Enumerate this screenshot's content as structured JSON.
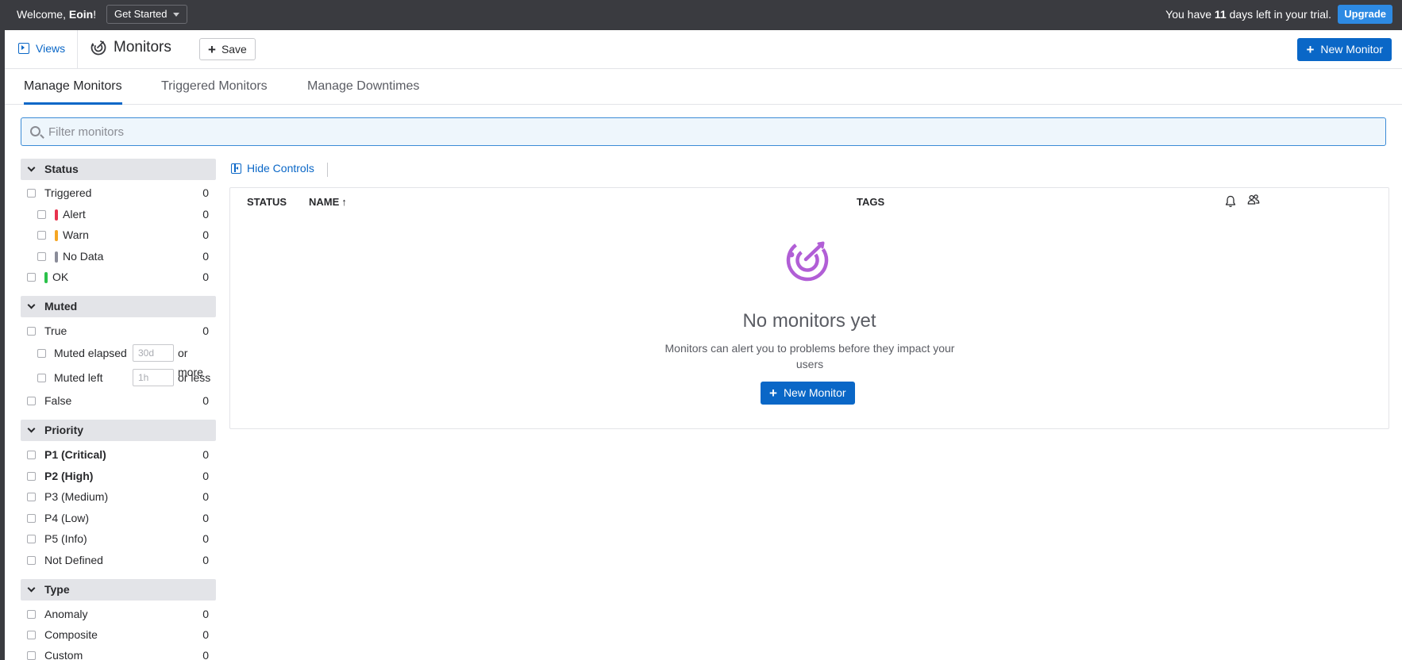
{
  "topbar": {
    "welcome_prefix": "Welcome, ",
    "user_name": "Eoin",
    "welcome_suffix": "!",
    "get_started": "Get Started",
    "trial_prefix": "You have ",
    "trial_days": "11",
    "trial_suffix": " days left in your trial.",
    "upgrade": "Upgrade"
  },
  "header": {
    "views": "Views",
    "title": "Monitors",
    "save": "Save",
    "new_monitor": "New Monitor"
  },
  "tabs": [
    {
      "label": "Manage Monitors",
      "active": true
    },
    {
      "label": "Triggered Monitors",
      "active": false
    },
    {
      "label": "Manage Downtimes",
      "active": false
    }
  ],
  "search": {
    "placeholder": "Filter monitors",
    "value": ""
  },
  "sidebar": {
    "status": {
      "title": "Status",
      "items": [
        {
          "label": "Triggered",
          "count": "0"
        },
        {
          "label": "Alert",
          "count": "0",
          "color": "#e8334e"
        },
        {
          "label": "Warn",
          "count": "0",
          "color": "#f5a623"
        },
        {
          "label": "No Data",
          "count": "0",
          "color": "#8a8c99"
        },
        {
          "label": "OK",
          "count": "0",
          "color": "#2bc14a"
        }
      ]
    },
    "muted": {
      "title": "Muted",
      "true_label": "True",
      "true_count": "0",
      "elapsed_label": "Muted elapsed",
      "elapsed_placeholder": "30d",
      "elapsed_suffix": "or more",
      "left_label": "Muted left",
      "left_placeholder": "1h",
      "left_suffix": "or less",
      "false_label": "False",
      "false_count": "0"
    },
    "priority": {
      "title": "Priority",
      "items": [
        {
          "label": "P1 (Critical)",
          "count": "0"
        },
        {
          "label": "P2 (High)",
          "count": "0"
        },
        {
          "label": "P3 (Medium)",
          "count": "0"
        },
        {
          "label": "P4 (Low)",
          "count": "0"
        },
        {
          "label": "P5 (Info)",
          "count": "0"
        },
        {
          "label": "Not Defined",
          "count": "0"
        }
      ]
    },
    "type": {
      "title": "Type",
      "items": [
        {
          "label": "Anomaly",
          "count": "0"
        },
        {
          "label": "Composite",
          "count": "0"
        },
        {
          "label": "Custom",
          "count": "0"
        }
      ]
    }
  },
  "main": {
    "hide_controls": "Hide Controls",
    "columns": {
      "status": "STATUS",
      "name": "NAME",
      "name_sort": "↑",
      "tags": "TAGS"
    },
    "empty": {
      "title": "No monitors yet",
      "description": "Monitors can alert you to problems before they impact your users",
      "button": "New Monitor"
    }
  },
  "colors": {
    "accent": "#0a67c7",
    "topbar": "#3a3b40",
    "monitor_icon": "#b15ed6"
  }
}
